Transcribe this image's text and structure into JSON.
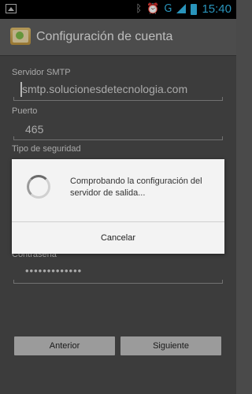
{
  "status_bar": {
    "time": "15:40",
    "icons": [
      "image-notification-icon",
      "bluetooth-icon",
      "alarm-icon",
      "wifi-icon",
      "signal-icon",
      "battery-icon"
    ]
  },
  "header": {
    "title": "Configuración de cuenta"
  },
  "form": {
    "smtp_label": "Servidor SMTP",
    "smtp_value": "smtp.solucionesdetecnologia.com",
    "port_label": "Puerto",
    "port_value": "465",
    "security_label": "Tipo de seguridad",
    "password_label": "Contraseña",
    "password_value": "•••••••••••••"
  },
  "buttons": {
    "previous": "Anterior",
    "next": "Siguiente"
  },
  "dialog": {
    "message": "Comprobando la configuración del servidor de salida...",
    "cancel": "Cancelar"
  },
  "colors": {
    "accent": "#33b5e5",
    "background": "#4a4a4a",
    "dialog": "#f3f3f3"
  }
}
